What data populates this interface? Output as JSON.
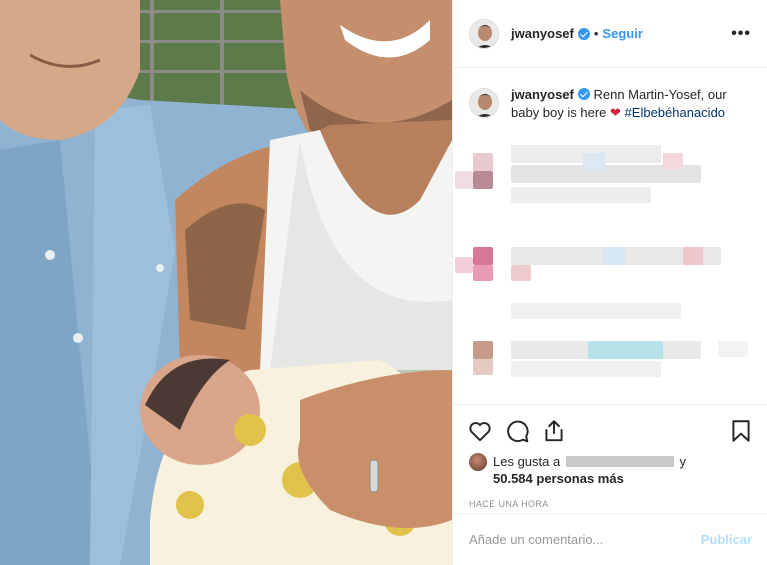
{
  "post": {
    "username": "jwanyosef",
    "follow_label": "Seguir",
    "separator": "•",
    "more_label": "•••",
    "caption_text": " Renn Martin-Yosef, our baby boy is here ",
    "caption_heart": "❤",
    "caption_hashtag": "#Elbebéhanacido",
    "likes_prefix": "Les gusta a",
    "likes_conj": "y",
    "likes_count": "50.584 personas más",
    "timestamp": "HACE UNA HORA",
    "comment_placeholder": "Añade un comentario...",
    "publish_label": "Publicar"
  },
  "colors": {
    "accent": "#3897f0",
    "heart": "#d4213a",
    "publish_disabled": "#b2dffc"
  },
  "icons": {
    "like": "heart-outline-icon",
    "comment": "speech-bubble-icon",
    "share": "share-arrow-icon",
    "save": "bookmark-icon",
    "verified": "verified-badge-icon"
  }
}
